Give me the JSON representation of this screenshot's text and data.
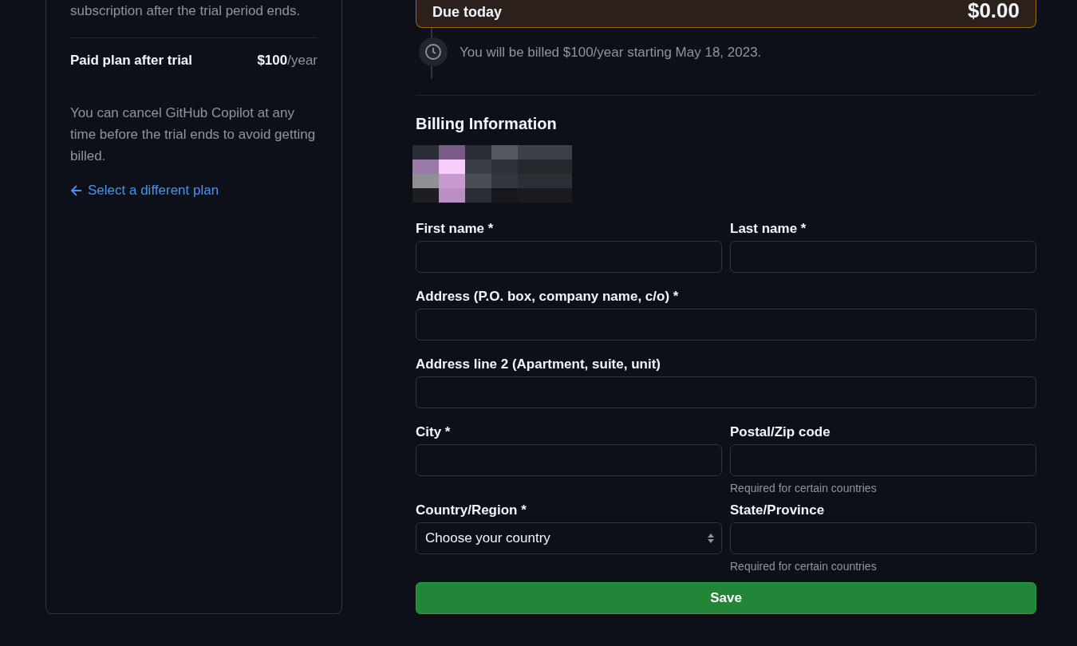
{
  "plan_card": {
    "intro": "subscription after the trial period ends.",
    "price_label": "Paid plan after trial",
    "price_amount": "$100",
    "price_period": "/year",
    "note": "You can cancel GitHub Copilot at any time before the trial ends to avoid getting billed.",
    "back_link": "Select a different plan"
  },
  "due": {
    "label": "Due today",
    "amount": "$0.00"
  },
  "timeline": {
    "text": "You will be billed $100/year starting May 18, 2023."
  },
  "billing": {
    "title": "Billing Information",
    "avatar": {
      "kind": "picture"
    },
    "rows": [
      [
        {
          "kind": "text",
          "label": "First name *"
        },
        {
          "kind": "text",
          "label": "Last name *"
        }
      ],
      [
        {
          "kind": "text",
          "label": "Address (P.O. box, company name, c/o) *"
        }
      ],
      [
        {
          "kind": "text",
          "label": "Address line 2 (Apartment, suite, unit)"
        }
      ],
      [
        {
          "kind": "text",
          "label": "City *"
        },
        {
          "kind": "text",
          "label": "Postal/Zip code",
          "hint": "Required for certain countries"
        }
      ],
      [
        {
          "kind": "select",
          "label": "Country/Region *",
          "value": "Choose your country"
        },
        {
          "kind": "text",
          "label": "State/Province",
          "hint": "Required for certain countries"
        }
      ]
    ],
    "submit": "Save"
  }
}
